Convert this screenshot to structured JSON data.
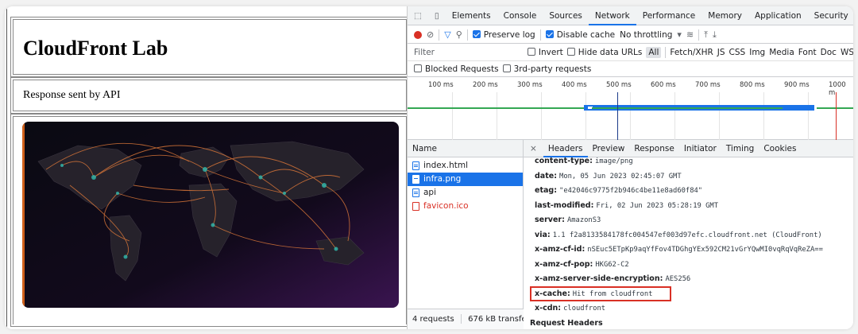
{
  "page": {
    "title": "CloudFront Lab",
    "text": "Response sent by API",
    "image_alt": "world network map"
  },
  "devtools": {
    "tabs": [
      "Elements",
      "Console",
      "Sources",
      "Network",
      "Performance",
      "Memory",
      "Application",
      "Security"
    ],
    "active_tab": "Network",
    "toolbar": {
      "preserve_log": "Preserve log",
      "disable_cache": "Disable cache",
      "throttling": "No throttling"
    },
    "filter": {
      "placeholder": "Filter",
      "invert": "Invert",
      "hide_data_urls": "Hide data URLs",
      "types": [
        "All",
        "Fetch/XHR",
        "JS",
        "CSS",
        "Img",
        "Media",
        "Font",
        "Doc",
        "WS"
      ]
    },
    "blocked_requests": "Blocked Requests",
    "third_party": "3rd-party requests",
    "timeline_ticks": [
      "100 ms",
      "200 ms",
      "300 ms",
      "400 ms",
      "500 ms",
      "600 ms",
      "700 ms",
      "800 ms",
      "900 ms",
      "1000 m"
    ],
    "list_header": "Name",
    "requests": [
      {
        "name": "index.html",
        "selected": false,
        "error": false
      },
      {
        "name": "infra.png",
        "selected": true,
        "error": false
      },
      {
        "name": "api",
        "selected": false,
        "error": false
      },
      {
        "name": "favicon.ico",
        "selected": false,
        "error": true
      }
    ],
    "status": {
      "requests": "4 requests",
      "transferred": "676 kB transfe"
    },
    "detail_tabs": [
      "Headers",
      "Preview",
      "Response",
      "Initiator",
      "Timing",
      "Cookies"
    ],
    "detail_close": "×",
    "headers": [
      {
        "k": "content-type:",
        "v": "image/png"
      },
      {
        "k": "date:",
        "v": "Mon, 05 Jun 2023 02:45:07 GMT"
      },
      {
        "k": "etag:",
        "v": "\"e42046c9775f2b946c4be11e8ad60f84\""
      },
      {
        "k": "last-modified:",
        "v": "Fri, 02 Jun 2023 05:28:19 GMT"
      },
      {
        "k": "server:",
        "v": "AmazonS3"
      },
      {
        "k": "via:",
        "v": "1.1 f2a8133584178fc004547ef003d97efc.cloudfront.net (CloudFront)"
      },
      {
        "k": "x-amz-cf-id:",
        "v": "nSEuc5ETpKp9aqYfFov4TDGhgYEx592CM21vGrYQwMI0vqRqVqReZA=="
      },
      {
        "k": "x-amz-cf-pop:",
        "v": "HKG62-C2"
      },
      {
        "k": "x-amz-server-side-encryption:",
        "v": "AES256"
      },
      {
        "k": "x-cache:",
        "v": "Hit from cloudfront"
      },
      {
        "k": "x-cdn:",
        "v": "cloudfront"
      }
    ],
    "next_section": "Request Headers",
    "colors": {
      "accent": "#1a73e8",
      "record": "#d93025",
      "highlight": "#d93025"
    }
  }
}
